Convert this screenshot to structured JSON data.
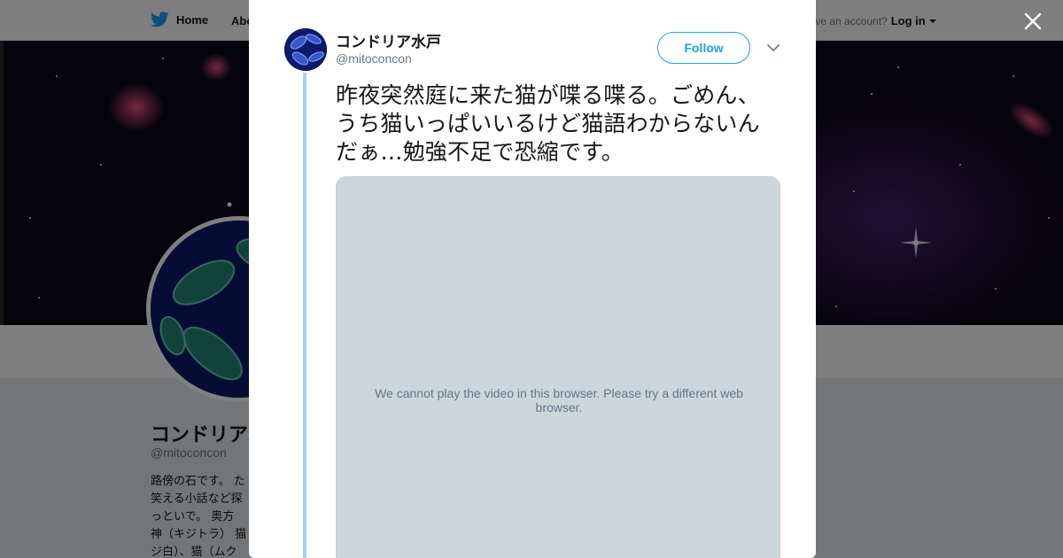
{
  "page": {
    "nav": {
      "home_label": "Home",
      "about_label": "About",
      "account_prompt": "Have an account?",
      "login_label": "Log in"
    },
    "profile": {
      "name": "コンドリア水戸",
      "handle": "@mitoconcon",
      "bio_lines": [
        "路傍の石です。 た",
        "笑える小話など探",
        "っといで。 奥方",
        "神（キジトラ） 猫",
        "ジ白）、猫（ムク"
      ]
    }
  },
  "tweet": {
    "author_name": "コンドリア水戸",
    "author_handle": "@mitoconcon",
    "follow_label": "Follow",
    "text": "昨夜突然庭に来た猫が喋る喋る。ごめん、うち猫いっぱいいるけど猫語わからないんだぁ…勉強不足で恐縮です。",
    "video_message": "We cannot play the video in this browser. Please try a different web browser."
  },
  "colors": {
    "accent": "#1da1f2",
    "thread_line": "#9fd3f5",
    "video_bg": "#ccd6dd",
    "overlay": "rgba(0,0,0,0.5)"
  },
  "icons": [
    "twitter-bird-icon",
    "close-icon",
    "chevron-down-icon"
  ]
}
